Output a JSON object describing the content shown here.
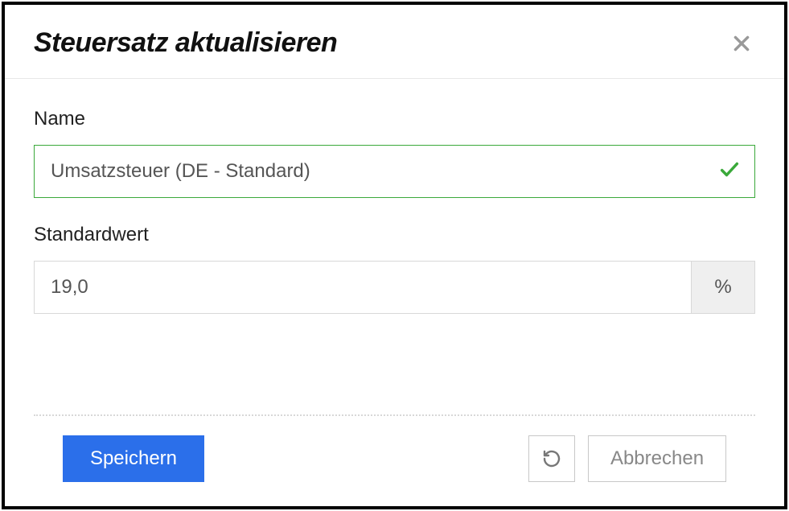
{
  "modal": {
    "title": "Steuersatz aktualisieren"
  },
  "form": {
    "name": {
      "label": "Name",
      "value": "Umsatzsteuer (DE - Standard)"
    },
    "standard": {
      "label": "Standardwert",
      "value": "19,0",
      "unit": "%"
    }
  },
  "actions": {
    "save": "Speichern",
    "cancel": "Abbrechen"
  }
}
